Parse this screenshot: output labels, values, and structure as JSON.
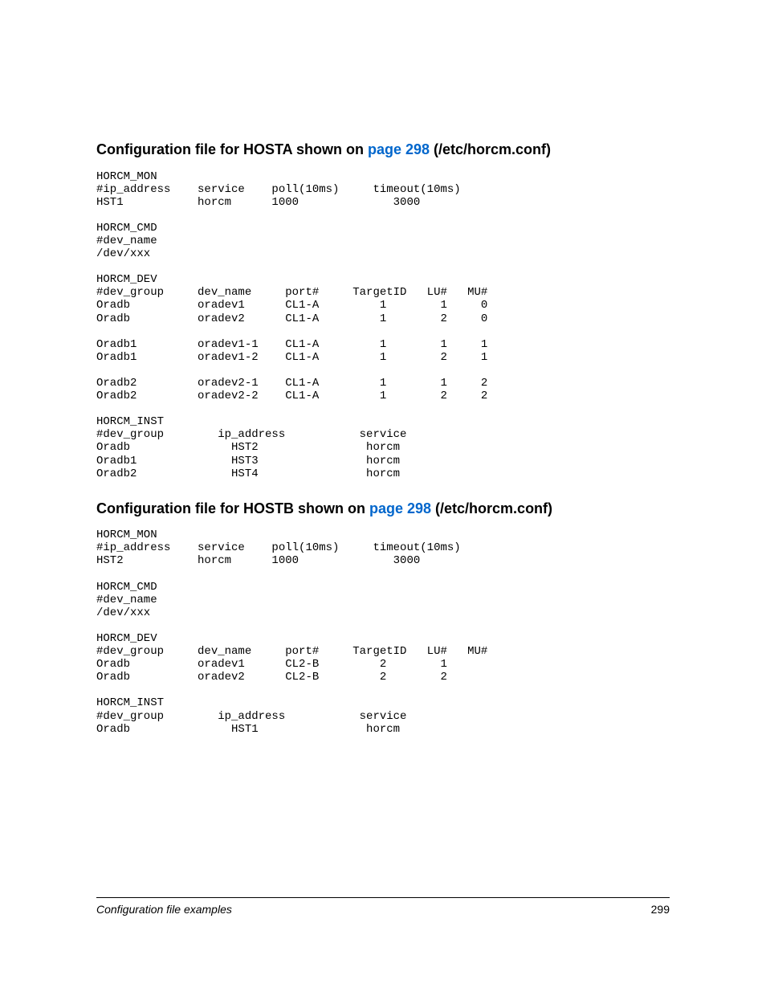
{
  "section1": {
    "heading_prefix": "Configuration file for HOSTA shown on ",
    "heading_link": "page 298",
    "heading_suffix": " (/etc/horcm.conf)",
    "body": "HORCM_MON\n#ip_address    service    poll(10ms)     timeout(10ms)\nHST1           horcm      1000              3000\n\nHORCM_CMD\n#dev_name\n/dev/xxx\n\nHORCM_DEV\n#dev_group     dev_name     port#     TargetID   LU#   MU#\nOradb          oradev1      CL1-A         1        1     0\nOradb          oradev2      CL1-A         1        2     0\n\nOradb1         oradev1-1    CL1-A         1        1     1\nOradb1         oradev1-2    CL1-A         1        2     1\n\nOradb2         oradev2-1    CL1-A         1        1     2\nOradb2         oradev2-2    CL1-A         1        2     2\n\nHORCM_INST\n#dev_group        ip_address           service\nOradb               HST2                horcm\nOradb1              HST3                horcm\nOradb2              HST4                horcm"
  },
  "section2": {
    "heading_prefix": "Configuration file for HOSTB shown on ",
    "heading_link": "page 298",
    "heading_suffix": " (/etc/horcm.conf)",
    "body": "HORCM_MON\n#ip_address    service    poll(10ms)     timeout(10ms)\nHST2           horcm      1000              3000\n\nHORCM_CMD\n#dev_name\n/dev/xxx\n\nHORCM_DEV\n#dev_group     dev_name     port#     TargetID   LU#   MU#\nOradb          oradev1      CL2-B         2        1\nOradb          oradev2      CL2-B         2        2\n\nHORCM_INST\n#dev_group        ip_address           service\nOradb               HST1                horcm"
  },
  "footer": {
    "label": "Configuration file examples",
    "page": "299"
  }
}
